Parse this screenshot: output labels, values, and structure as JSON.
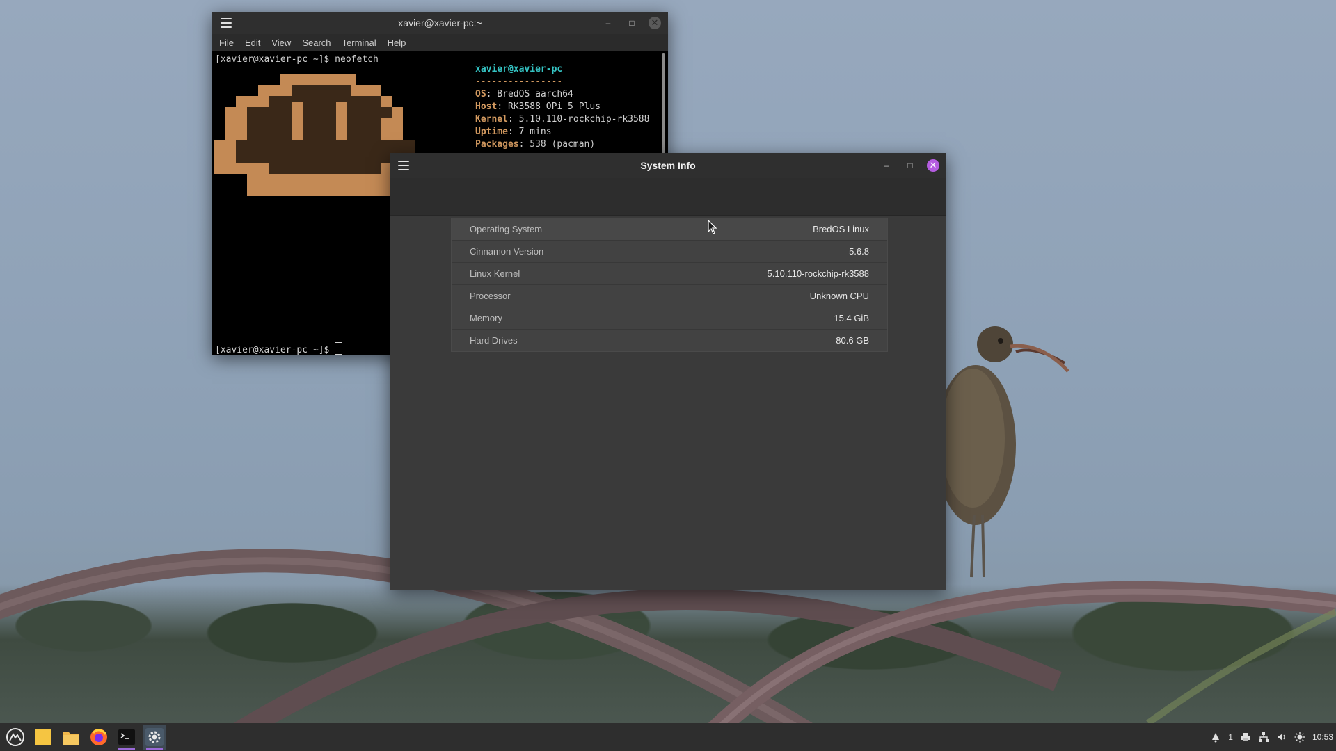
{
  "colors": {
    "accent_close": "#b45ce0",
    "taskbar_bg": "#2e2e2e",
    "neofetch_key": "#d39a60",
    "neofetch_user": "#35c4c4"
  },
  "terminal": {
    "title": "xavier@xavier-pc:~",
    "menu": [
      "File",
      "Edit",
      "View",
      "Search",
      "Terminal",
      "Help"
    ],
    "command_line": "[xavier@xavier-pc ~]$ neofetch",
    "prompt_line": "[xavier@xavier-pc ~]$ ",
    "neofetch": {
      "user": "xavier@xavier-pc",
      "separator": "----------------",
      "os_key": "OS",
      "os_val": ": BredOS aarch64",
      "host_key": "Host",
      "host_val": ": RK3588 OPi 5 Plus",
      "kernel_key": "Kernel",
      "kernel_val": ": 5.10.110-rockchip-rk3588",
      "uptime_key": "Uptime",
      "uptime_val": ": 7 mins",
      "packages_key": "Packages",
      "packages_val": ": 538 (pacman)"
    }
  },
  "sysinfo": {
    "title": "System Info",
    "rows": [
      {
        "label": "Operating System",
        "value": "BredOS Linux"
      },
      {
        "label": "Cinnamon Version",
        "value": "5.6.8"
      },
      {
        "label": "Linux Kernel",
        "value": "5.10.110-rockchip-rk3588"
      },
      {
        "label": "Processor",
        "value": "Unknown CPU"
      },
      {
        "label": "Memory",
        "value": "15.4 GiB"
      },
      {
        "label": "Hard Drives",
        "value": "80.6 GB"
      }
    ]
  },
  "taskbar": {
    "notification_count": "1",
    "clock": "10:53",
    "launchers": [
      "menu-icon",
      "notes-icon",
      "files-icon",
      "firefox-icon",
      "terminal-icon",
      "settings-icon"
    ]
  }
}
